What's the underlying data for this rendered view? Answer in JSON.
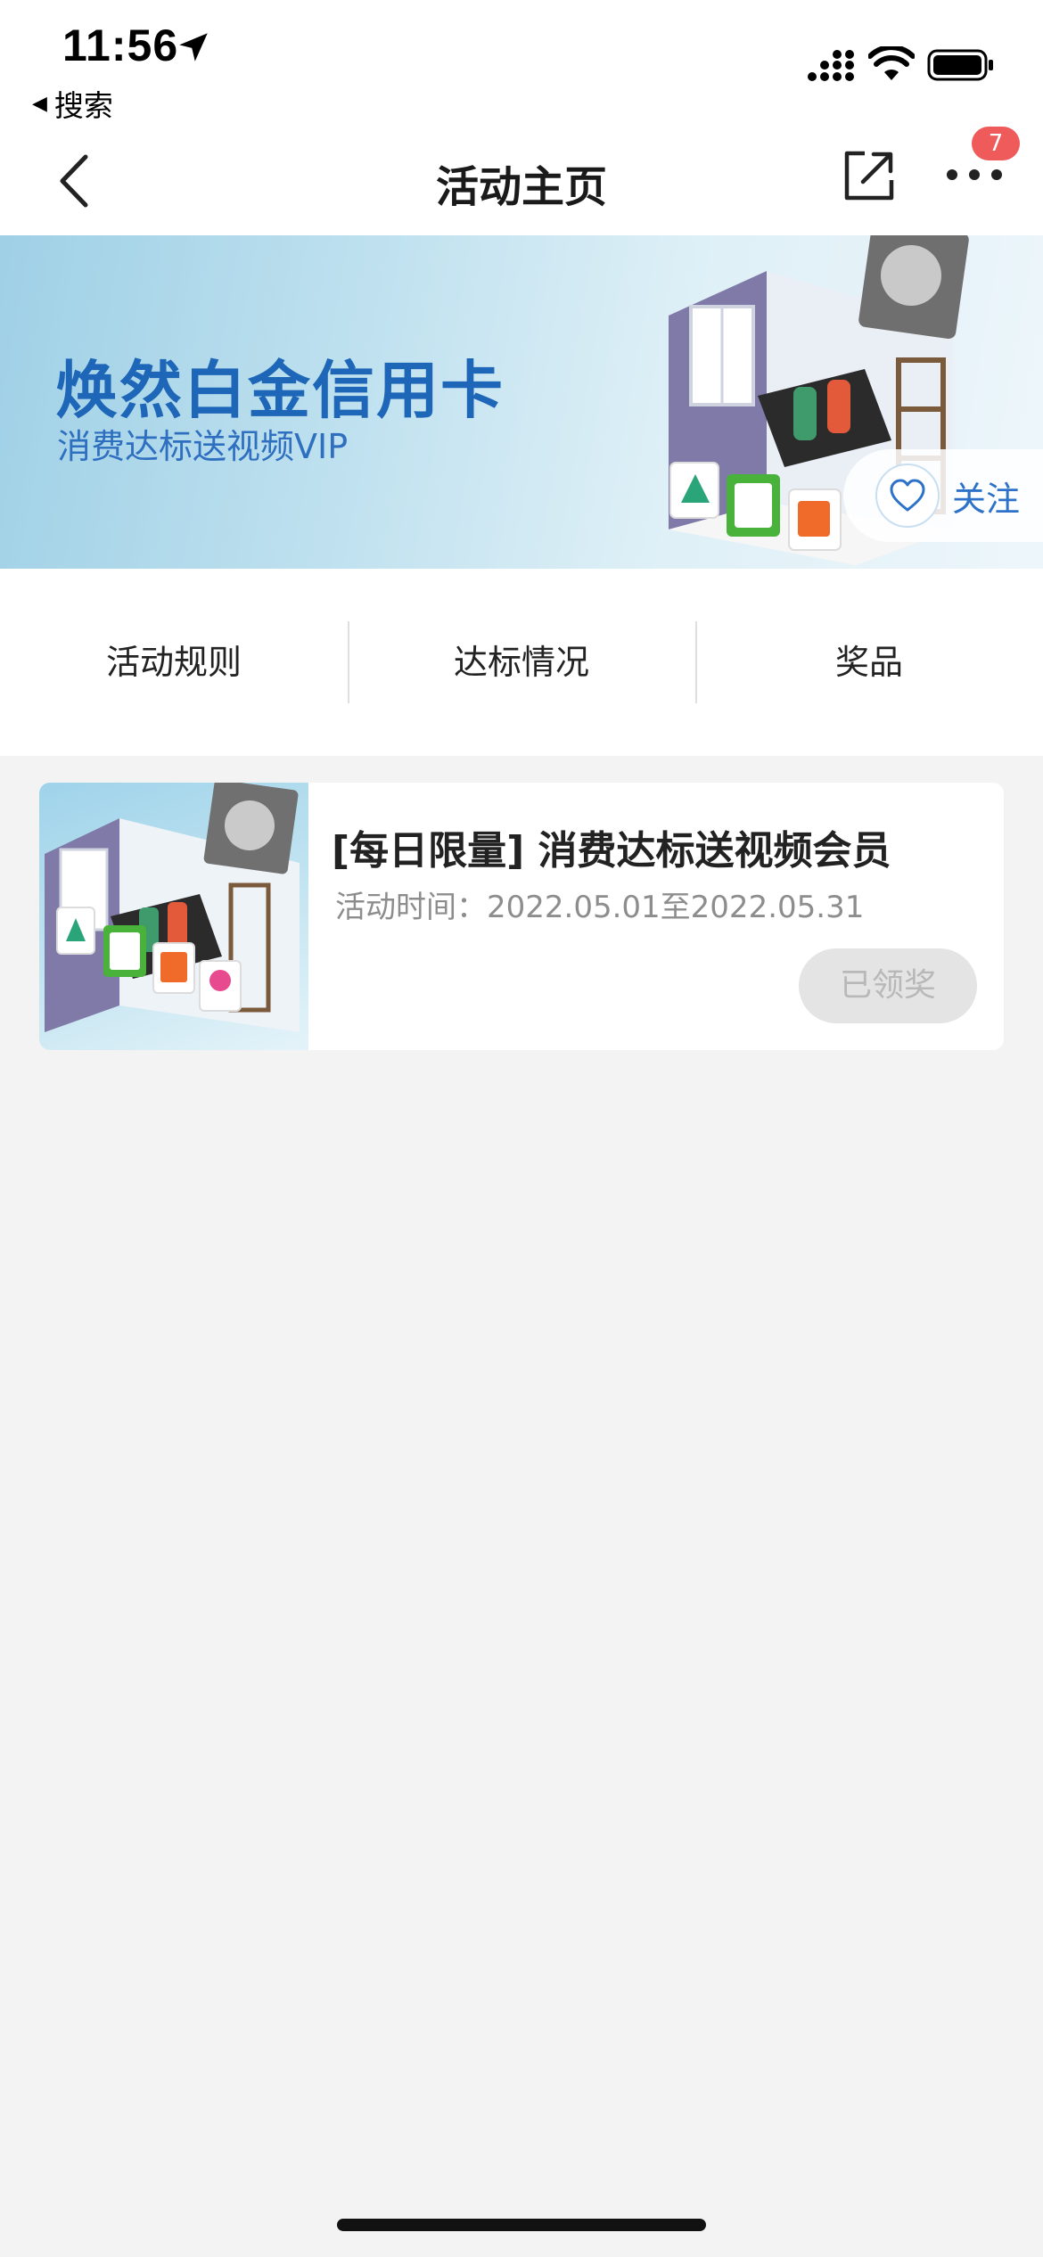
{
  "status_bar": {
    "time": "11:56",
    "back_app_label": "搜索",
    "icons": [
      "location-arrow-icon",
      "cellular-signal-icon",
      "wifi-icon",
      "battery-icon"
    ]
  },
  "nav": {
    "title": "活动主页",
    "badge_count": "7",
    "icons": [
      "back-chevron-icon",
      "share-icon",
      "more-icon"
    ]
  },
  "banner": {
    "title": "焕然白金信用卡",
    "subtitle": "消费达标送视频VIP",
    "follow_label": "关注"
  },
  "tabs": [
    {
      "label": "活动规则"
    },
    {
      "label": "达标情况"
    },
    {
      "label": "奖品"
    }
  ],
  "activity": {
    "title": "[每日限量] 消费达标送视频会员",
    "time_text": "活动时间：2022.05.01至2022.05.31",
    "button_label": "已领奖"
  },
  "colors": {
    "accent_blue": "#1e66b8",
    "badge_red": "#ef5a5a",
    "background": "#f3f3f4",
    "disabled_button": "#e4e4e4"
  }
}
